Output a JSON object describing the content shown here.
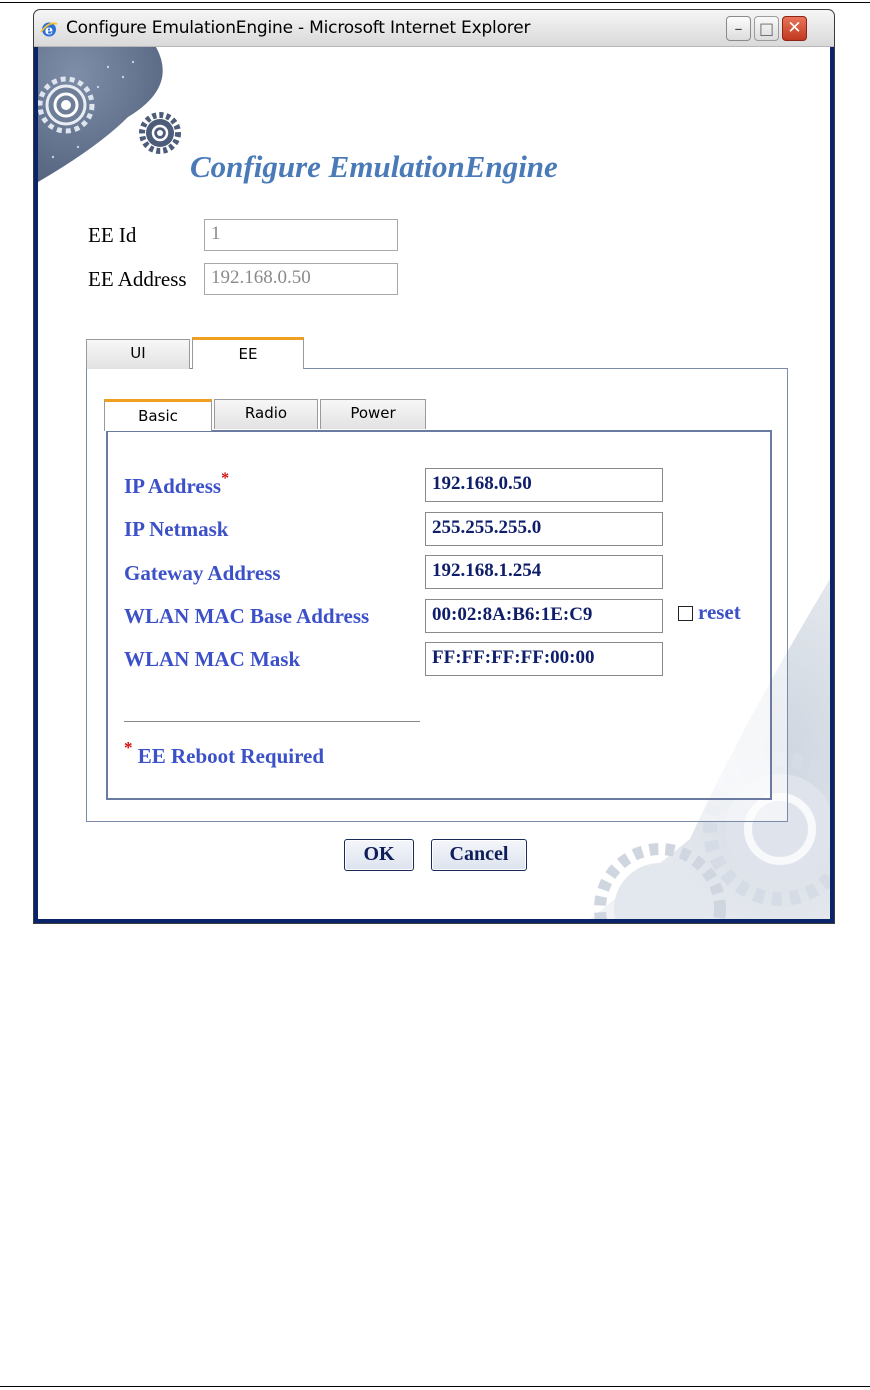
{
  "window": {
    "title": "Configure EmulationEngine - Microsoft Internet Explorer",
    "minimize_symbol": "–",
    "maximize_symbol": "□",
    "close_symbol": "✕"
  },
  "page": {
    "heading": "Configure EmulationEngine"
  },
  "identity": {
    "ee_id_label": "EE Id",
    "ee_id_value": "1",
    "ee_address_label": "EE Address",
    "ee_address_value": "192.168.0.50"
  },
  "outer_tabs": [
    {
      "label": "UI",
      "active": false
    },
    {
      "label": "EE",
      "active": true
    }
  ],
  "inner_tabs": [
    {
      "label": "Basic",
      "active": true
    },
    {
      "label": "Radio",
      "active": false
    },
    {
      "label": "Power",
      "active": false
    }
  ],
  "basic": {
    "fields": [
      {
        "label": "IP Address",
        "required_marker": "*",
        "value": "192.168.0.50"
      },
      {
        "label": "IP Netmask",
        "value": "255.255.255.0"
      },
      {
        "label": "Gateway Address",
        "value": "192.168.1.254"
      },
      {
        "label": "WLAN MAC Base Address",
        "value": "00:02:8A:B6:1E:C9"
      },
      {
        "label": "WLAN MAC Mask",
        "value": "FF:FF:FF:FF:00:00"
      }
    ],
    "reset_label": "reset",
    "reset_checked": false,
    "note_marker": "*",
    "note": "EE Reboot Required"
  },
  "buttons": {
    "ok": "OK",
    "cancel": "Cancel"
  },
  "colors": {
    "label_blue": "#3c50c8",
    "heading_blue": "#4a7ab8",
    "required_red": "#d01010",
    "tab_accent": "#f0a020"
  },
  "icons": {
    "browser": "internet-explorer-icon",
    "decoration": "gears-decoration"
  }
}
